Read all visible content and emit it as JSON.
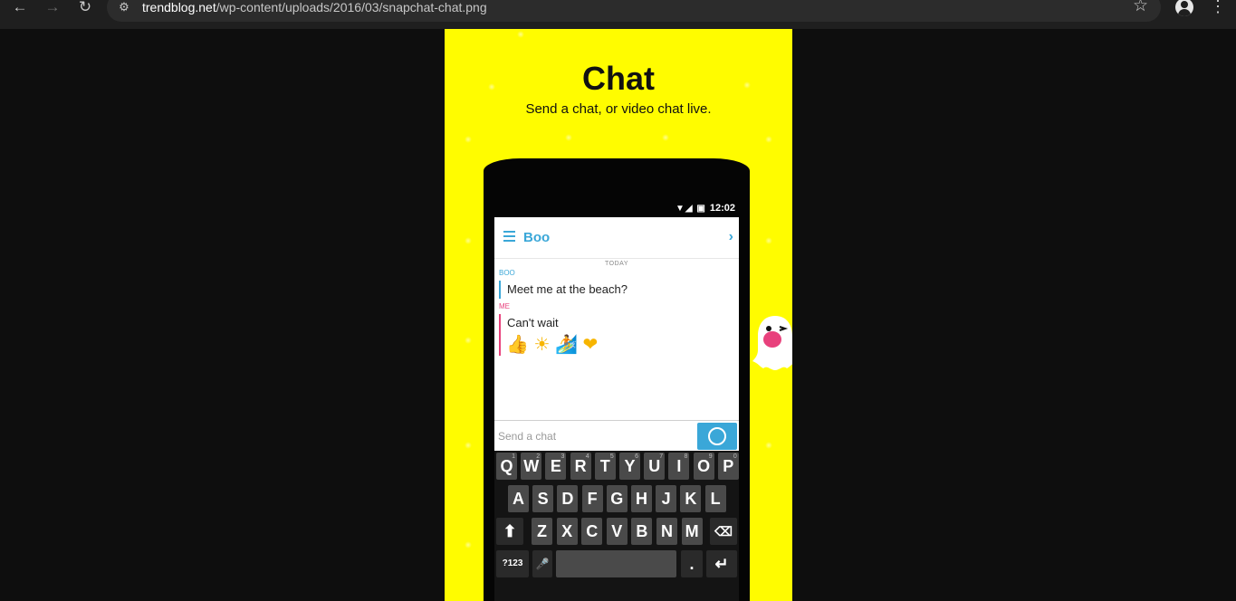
{
  "browser": {
    "back_label": "←",
    "forward_label": "→",
    "reload_label": "↻",
    "url_host": "trendblog.net",
    "url_path": "/wp-content/uploads/2016/03/snapchat-chat.png",
    "site_info_icon": "tune-icon",
    "bookmark_icon": "star-outline-icon",
    "profile_icon": "person-icon",
    "menu_label": "⋮"
  },
  "poster": {
    "title": "Chat",
    "subtitle": "Send a chat, or video chat live.",
    "background_color": "#fffc00"
  },
  "phone": {
    "status_time": "12:02",
    "status_icons": "▼◢ ▣",
    "chat_name": "Boo",
    "chevron": "›",
    "day_label": "TODAY",
    "messages": [
      {
        "sender": "BOO",
        "text": "Meet me at the beach?"
      },
      {
        "sender": "ME",
        "text": "Can't wait"
      }
    ],
    "emojis": [
      "👍",
      "☀",
      "🏄",
      "❤"
    ],
    "input_placeholder": "Send a chat",
    "accent_color": "#3aa7d8",
    "me_color": "#e8417c"
  },
  "keyboard": {
    "row1": [
      "Q",
      "W",
      "E",
      "R",
      "T",
      "Y",
      "U",
      "I",
      "O",
      "P"
    ],
    "row1_hints": [
      "1",
      "2",
      "3",
      "4",
      "5",
      "6",
      "7",
      "8",
      "9",
      "0"
    ],
    "row2": [
      "A",
      "S",
      "D",
      "F",
      "G",
      "H",
      "J",
      "K",
      "L"
    ],
    "row3": [
      "Z",
      "X",
      "C",
      "V",
      "B",
      "N",
      "M"
    ],
    "shift": "⬆",
    "backspace": "⌫",
    "symbols": "?123",
    "mic": "🎤",
    "period": ".",
    "enter": "↵"
  }
}
